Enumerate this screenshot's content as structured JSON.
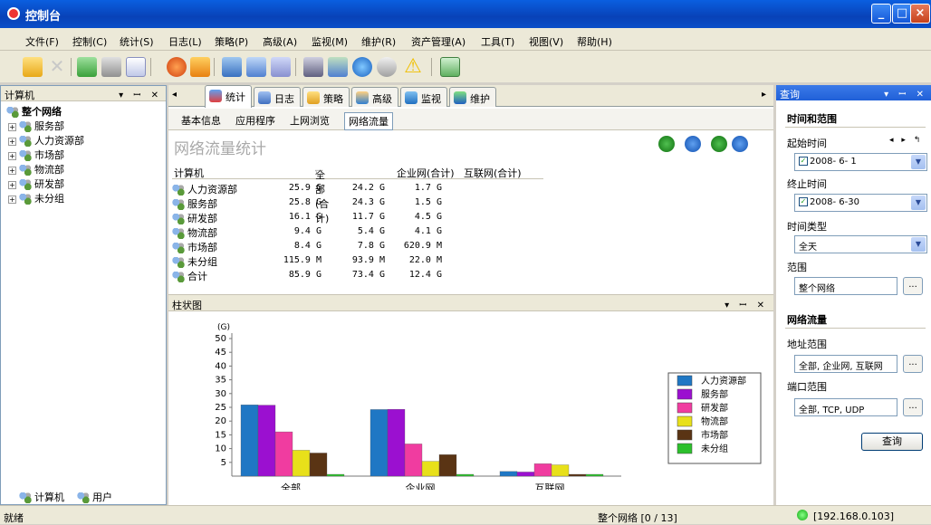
{
  "window": {
    "title": "控制台"
  },
  "menu": [
    "文件(F)",
    "控制(C)",
    "统计(S)",
    "日志(L)",
    "策略(P)",
    "高级(A)",
    "监视(M)",
    "维护(R)",
    "资产管理(A)",
    "工具(T)",
    "视图(V)",
    "帮助(H)"
  ],
  "left_panel": {
    "title": "计算机",
    "root": "整个网络",
    "items": [
      "服务部",
      "人力资源部",
      "市场部",
      "物流部",
      "研发部",
      "未分组"
    ],
    "bottom_tabs": [
      "计算机",
      "用户"
    ]
  },
  "tabs": [
    "统计",
    "日志",
    "策略",
    "高级",
    "监视",
    "维护"
  ],
  "subtabs": [
    "基本信息",
    "应用程序",
    "上网浏览",
    "网络流量"
  ],
  "content_title": "网络流量统计",
  "table": {
    "headers": [
      "计算机",
      "全部(合计)",
      "企业网(合计)",
      "互联网(合计)"
    ],
    "sort_indicator": "▽",
    "rows": [
      [
        "人力资源部",
        "25.9 G",
        "24.2 G",
        "1.7 G"
      ],
      [
        "服务部",
        "25.8 G",
        "24.3 G",
        "1.5 G"
      ],
      [
        "研发部",
        "16.1 G",
        "11.7 G",
        "4.5 G"
      ],
      [
        "物流部",
        "9.4 G",
        "5.4 G",
        "4.1 G"
      ],
      [
        "市场部",
        "8.4 G",
        "7.8 G",
        "620.9 M"
      ],
      [
        "未分组",
        "115.9 M",
        "93.9 M",
        "22.0 M"
      ],
      [
        "合计",
        "85.9 G",
        "73.4 G",
        "12.4 G"
      ]
    ]
  },
  "chart_panel": {
    "title": "柱状图"
  },
  "chart_data": {
    "type": "bar",
    "unit": "(G)",
    "categories": [
      "全部",
      "企业网",
      "互联网"
    ],
    "ylim": [
      0,
      50
    ],
    "yticks": [
      5,
      10,
      15,
      20,
      25,
      30,
      35,
      40,
      45,
      50
    ],
    "legend_position": "right",
    "series": [
      {
        "name": "人力资源部",
        "color": "#1f77c4",
        "values": [
          25.9,
          24.2,
          1.7
        ]
      },
      {
        "name": "服务部",
        "color": "#9b10d0",
        "values": [
          25.8,
          24.3,
          1.5
        ]
      },
      {
        "name": "研发部",
        "color": "#f03ca0",
        "values": [
          16.1,
          11.7,
          4.5
        ]
      },
      {
        "name": "物流部",
        "color": "#e8e01a",
        "values": [
          9.4,
          5.4,
          4.1
        ]
      },
      {
        "name": "市场部",
        "color": "#5a3414",
        "values": [
          8.4,
          7.8,
          0.6
        ]
      },
      {
        "name": "未分组",
        "color": "#2cc02c",
        "values": [
          0.1,
          0.1,
          0.0
        ]
      }
    ]
  },
  "query_panel": {
    "title": "查询",
    "section_time": "时间和范围",
    "start_label": "起始时间",
    "start_value": "2008- 6- 1",
    "end_label": "终止时间",
    "end_value": "2008- 6-30",
    "type_label": "时间类型",
    "type_value": "全天",
    "range_label": "范围",
    "range_value": "整个网络",
    "section_traffic": "网络流量",
    "addr_label": "地址范围",
    "addr_value": "全部, 企业网, 互联网",
    "port_label": "端口范围",
    "port_value": "全部, TCP, UDP",
    "query_button": "查询",
    "browse": "..."
  },
  "status": {
    "left": "就绪",
    "middle": "整个网络 [0 / 13]",
    "right": "[192.168.0.103]"
  }
}
